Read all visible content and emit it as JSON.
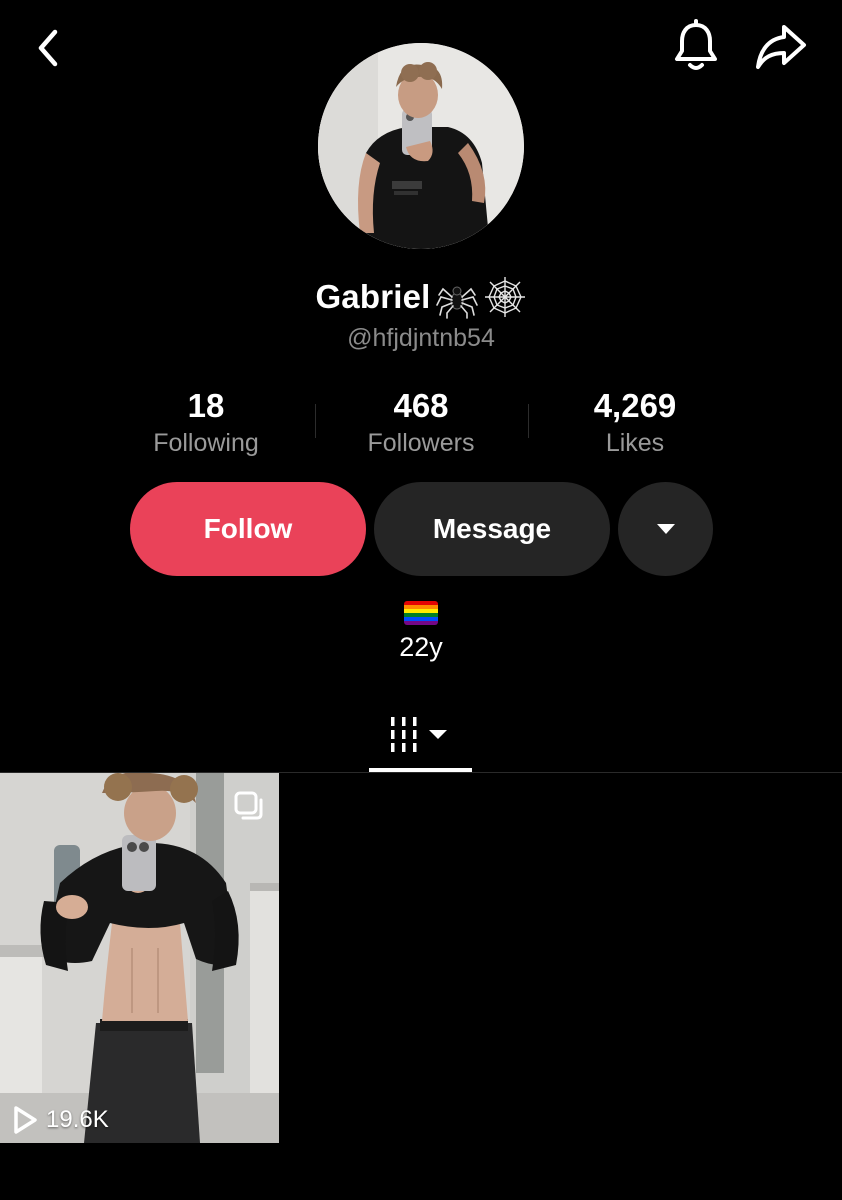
{
  "header": {
    "back_icon": "chevron-left-icon",
    "bell_icon": "bell-icon",
    "share_icon": "share-arrow-icon"
  },
  "profile": {
    "display_name": "Gabriel",
    "name_emojis": [
      "spider-icon",
      "spider-web-icon"
    ],
    "username": "@hfjdjntnb54",
    "age": "22y",
    "bio_flag": "rainbow-flag-icon"
  },
  "stats": [
    {
      "value": "18",
      "label": "Following"
    },
    {
      "value": "468",
      "label": "Followers"
    },
    {
      "value": "4,269",
      "label": "Likes"
    }
  ],
  "actions": {
    "follow_label": "Follow",
    "message_label": "Message",
    "more_icon": "caret-down-icon"
  },
  "tabs": {
    "grid_icon": "videos-grid-icon"
  },
  "videos": [
    {
      "views": "19.6K",
      "type_icon": "multi-photo-icon"
    }
  ],
  "colors": {
    "background": "#000000",
    "follow_button": "#ea4259",
    "secondary_button": "#252525",
    "muted_text": "#9a9a9a"
  }
}
